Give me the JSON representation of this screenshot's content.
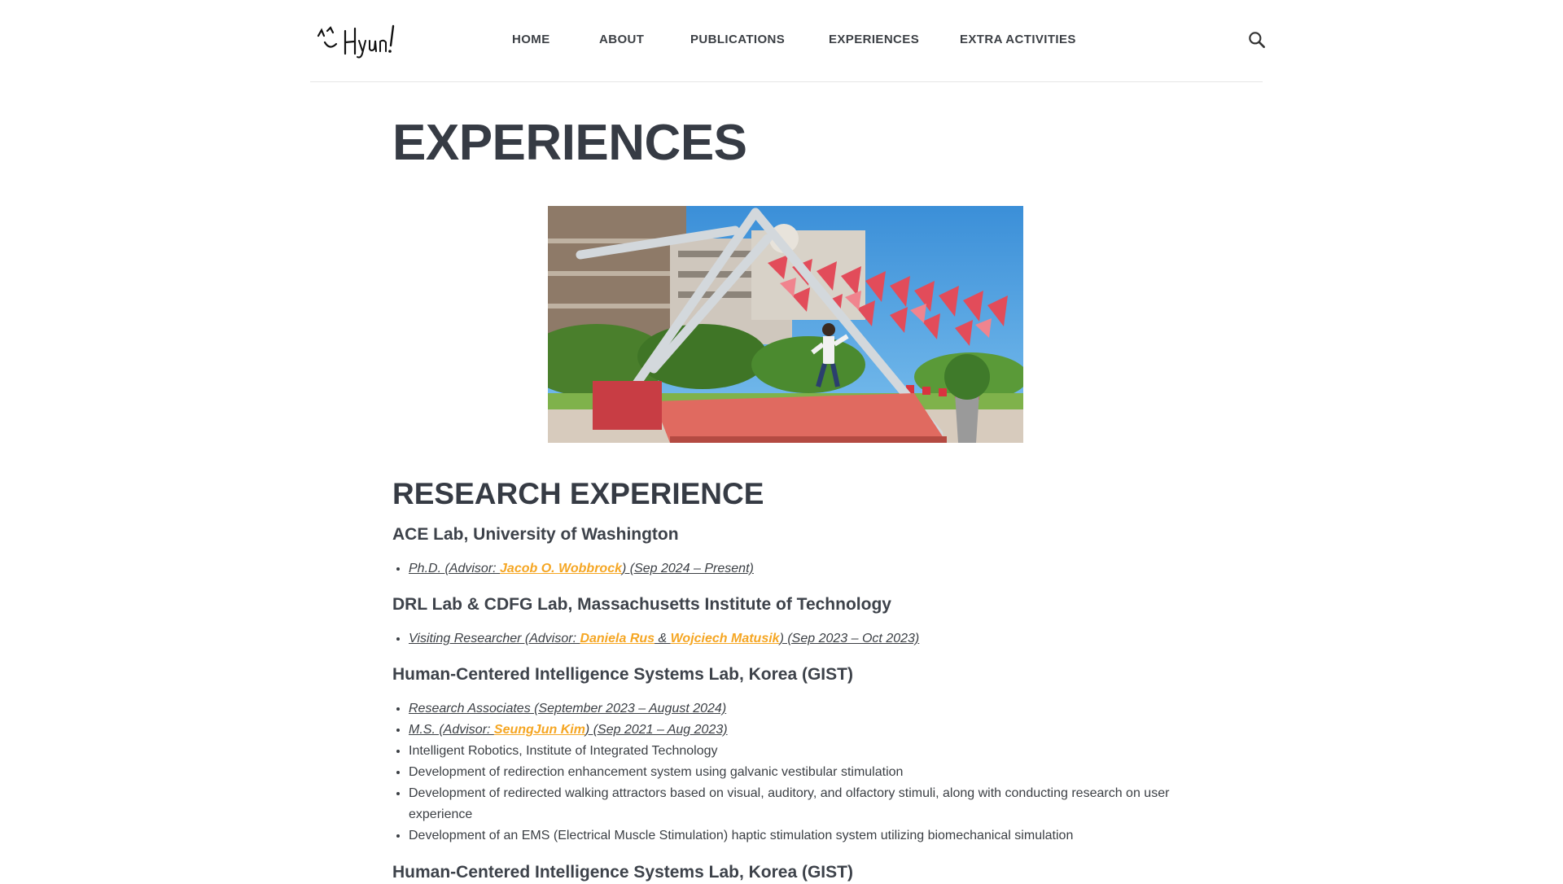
{
  "header": {
    "logo_text": "^_^ Hyun!",
    "nav": [
      "HOME",
      "ABOUT",
      "PUBLICATIONS",
      "EXPERIENCES",
      "EXTRA ACTIVITIES"
    ],
    "search_icon": "search-icon"
  },
  "page": {
    "title": "EXPERIENCES",
    "hero_image": "outdoor-installation-photo"
  },
  "research": {
    "heading": "RESEARCH EXPERIENCE",
    "ace": {
      "title": "ACE Lab, University of Washington",
      "item1_pre": "Ph.D. (Advisor: ",
      "item1_link": "Jacob O. Wobbrock",
      "item1_post": ") (Sep 2024 – Present)"
    },
    "drl": {
      "title": "DRL Lab & CDFG Lab, Massachusetts Institute of Technology",
      "item1_pre": "Visiting Researcher (Advisor: ",
      "item1_link1": "Daniela Rus",
      "item1_mid": " & ",
      "item1_link2": "Wojciech Matusik",
      "item1_post": ") (Sep 2023 – Oct 2023)"
    },
    "hci1": {
      "title": "Human-Centered Intelligence Systems Lab, Korea (GIST)",
      "item1": "Research Associates (September 2023 – August 2024)",
      "item2_pre": "M.S. (Advisor: ",
      "item2_link": "SeungJun Kim",
      "item2_post": ") (Sep 2021 – Aug 2023)",
      "item3": "Intelligent Robotics, Institute of Integrated Technology",
      "item4": "Development of redirection enhancement system using galvanic vestibular stimulation",
      "item5": "Development of redirected walking attractors based on visual, auditory, and olfactory stimuli, along with conducting research on user experience",
      "item6": "Development of an EMS (Electrical Muscle Stimulation) haptic stimulation system utilizing biomechanical simulation"
    },
    "hci2": {
      "title": "Human-Centered Intelligence Systems Lab, Korea (GIST)"
    }
  }
}
